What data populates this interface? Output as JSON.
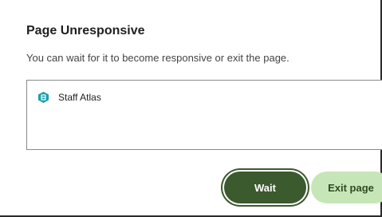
{
  "dialog": {
    "title": "Page Unresponsive",
    "message": "You can wait for it to become responsive or exit the page.",
    "items": [
      {
        "label": "Staff Atlas",
        "icon": "staff-atlas-app-icon",
        "icon_color": "#1a9fb0"
      }
    ],
    "buttons": {
      "wait": "Wait",
      "exit": "Exit page"
    },
    "colors": {
      "wait_bg": "#3b5a2e",
      "exit_bg": "#c7e6b7"
    }
  }
}
